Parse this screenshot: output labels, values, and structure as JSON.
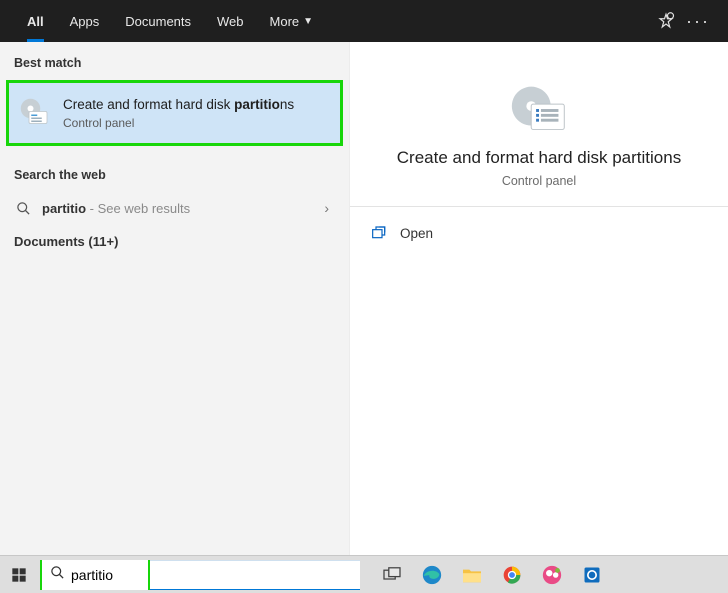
{
  "header": {
    "tabs": [
      "All",
      "Apps",
      "Documents",
      "Web",
      "More"
    ],
    "active_tab_index": 0
  },
  "left": {
    "best_match_label": "Best match",
    "best_match": {
      "title_plain_prefix": "Create and format hard disk ",
      "title_bold": "partitio",
      "title_plain_suffix": "ns",
      "subtitle": "Control panel"
    },
    "search_web_label": "Search the web",
    "web_result": {
      "query_bold": "partitio",
      "hint": " - See web results"
    },
    "documents_label": "Documents (11+)"
  },
  "right": {
    "title": "Create and format hard disk partitions",
    "subtitle": "Control panel",
    "actions": {
      "open": "Open"
    }
  },
  "taskbar": {
    "search_value": "partitio"
  },
  "icons": {
    "feedback": "feedback-icon",
    "overflow": "overflow-icon",
    "search": "search-icon",
    "chevron": "chevron-right-icon",
    "open": "open-icon",
    "start": "start-icon",
    "taskview": "task-view-icon",
    "edge": "edge-icon",
    "explorer": "file-explorer-icon",
    "chrome": "chrome-icon",
    "teams": "teams-icon",
    "outlook": "outlook-icon"
  }
}
